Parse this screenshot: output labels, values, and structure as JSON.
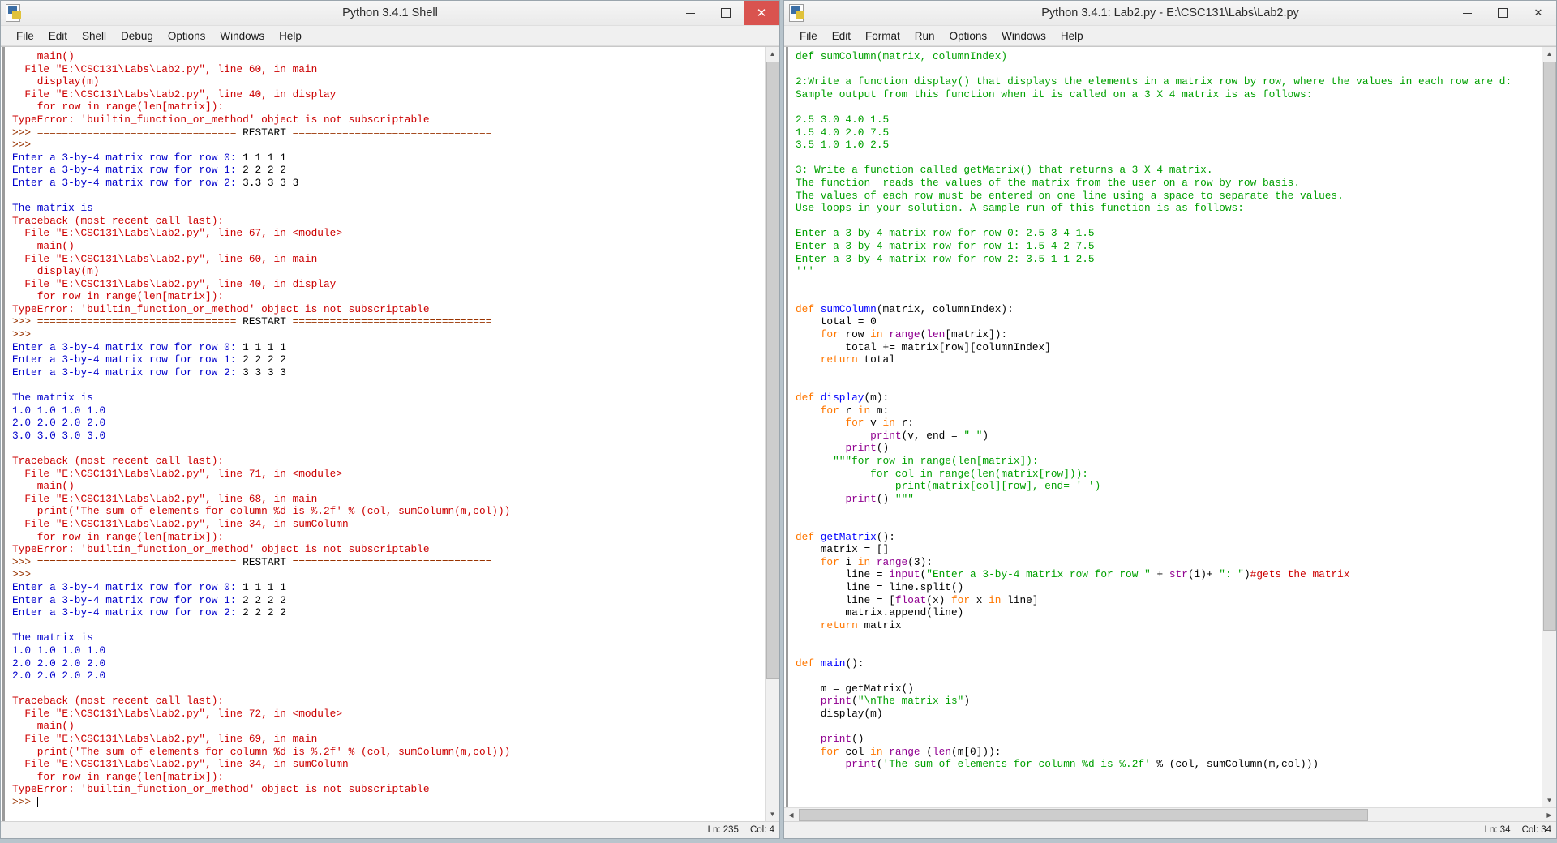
{
  "shell_window": {
    "title": "Python 3.4.1 Shell",
    "icon": "python-logo-icon",
    "menus": [
      "File",
      "Edit",
      "Shell",
      "Debug",
      "Options",
      "Windows",
      "Help"
    ],
    "window_buttons": {
      "minimize": "–",
      "maximize": "□",
      "close": "✕"
    },
    "status": {
      "line": "Ln: 235",
      "col": "Col: 4"
    },
    "output_lines": [
      {
        "t": "    main()",
        "c": "red"
      },
      {
        "t": "  File \"E:\\CSC131\\Labs\\Lab2.py\", line 60, in main",
        "c": "red"
      },
      {
        "t": "    display(m)",
        "c": "red"
      },
      {
        "t": "  File \"E:\\CSC131\\Labs\\Lab2.py\", line 40, in display",
        "c": "red"
      },
      {
        "t": "    for row in range(len[matrix]):",
        "c": "red"
      },
      {
        "t": "TypeError: 'builtin_function_or_method' object is not subscriptable",
        "c": "red"
      },
      {
        "t": ">>> ================================ RESTART ================================",
        "c": "restart"
      },
      {
        "t": ">>> ",
        "c": "brown"
      },
      {
        "t": "Enter a 3-by-4 matrix row for row 0: 1 1 1 1",
        "c": "prompt",
        "prompt": "Enter a 3-by-4 matrix row for row 0: ",
        "input": "1 1 1 1"
      },
      {
        "t": "Enter a 3-by-4 matrix row for row 1: 2 2 2 2",
        "c": "prompt",
        "prompt": "Enter a 3-by-4 matrix row for row 1: ",
        "input": "2 2 2 2"
      },
      {
        "t": "Enter a 3-by-4 matrix row for row 2: 3.3 3 3 3",
        "c": "prompt",
        "prompt": "Enter a 3-by-4 matrix row for row 2: ",
        "input": "3.3 3 3 3"
      },
      {
        "t": "",
        "c": "blank"
      },
      {
        "t": "The matrix is",
        "c": "blue"
      },
      {
        "t": "Traceback (most recent call last):",
        "c": "red"
      },
      {
        "t": "  File \"E:\\CSC131\\Labs\\Lab2.py\", line 67, in <module>",
        "c": "red"
      },
      {
        "t": "    main()",
        "c": "red"
      },
      {
        "t": "  File \"E:\\CSC131\\Labs\\Lab2.py\", line 60, in main",
        "c": "red"
      },
      {
        "t": "    display(m)",
        "c": "red"
      },
      {
        "t": "  File \"E:\\CSC131\\Labs\\Lab2.py\", line 40, in display",
        "c": "red"
      },
      {
        "t": "    for row in range(len[matrix]):",
        "c": "red"
      },
      {
        "t": "TypeError: 'builtin_function_or_method' object is not subscriptable",
        "c": "red"
      },
      {
        "t": ">>> ================================ RESTART ================================",
        "c": "restart"
      },
      {
        "t": ">>> ",
        "c": "brown"
      },
      {
        "t": "Enter a 3-by-4 matrix row for row 0: 1 1 1 1",
        "c": "prompt",
        "prompt": "Enter a 3-by-4 matrix row for row 0: ",
        "input": "1 1 1 1"
      },
      {
        "t": "Enter a 3-by-4 matrix row for row 1: 2 2 2 2",
        "c": "prompt",
        "prompt": "Enter a 3-by-4 matrix row for row 1: ",
        "input": "2 2 2 2"
      },
      {
        "t": "Enter a 3-by-4 matrix row for row 2: 3 3 3 3",
        "c": "prompt",
        "prompt": "Enter a 3-by-4 matrix row for row 2: ",
        "input": "3 3 3 3"
      },
      {
        "t": "",
        "c": "blank"
      },
      {
        "t": "The matrix is",
        "c": "blue"
      },
      {
        "t": "1.0 1.0 1.0 1.0",
        "c": "blue"
      },
      {
        "t": "2.0 2.0 2.0 2.0",
        "c": "blue"
      },
      {
        "t": "3.0 3.0 3.0 3.0",
        "c": "blue"
      },
      {
        "t": "",
        "c": "blank"
      },
      {
        "t": "Traceback (most recent call last):",
        "c": "red"
      },
      {
        "t": "  File \"E:\\CSC131\\Labs\\Lab2.py\", line 71, in <module>",
        "c": "red"
      },
      {
        "t": "    main()",
        "c": "red"
      },
      {
        "t": "  File \"E:\\CSC131\\Labs\\Lab2.py\", line 68, in main",
        "c": "red"
      },
      {
        "t": "    print('The sum of elements for column %d is %.2f' % (col, sumColumn(m,col)))",
        "c": "red"
      },
      {
        "t": "  File \"E:\\CSC131\\Labs\\Lab2.py\", line 34, in sumColumn",
        "c": "red"
      },
      {
        "t": "    for row in range(len[matrix]):",
        "c": "red"
      },
      {
        "t": "TypeError: 'builtin_function_or_method' object is not subscriptable",
        "c": "red"
      },
      {
        "t": ">>> ================================ RESTART ================================",
        "c": "restart"
      },
      {
        "t": ">>> ",
        "c": "brown"
      },
      {
        "t": "Enter a 3-by-4 matrix row for row 0: 1 1 1 1",
        "c": "prompt",
        "prompt": "Enter a 3-by-4 matrix row for row 0: ",
        "input": "1 1 1 1"
      },
      {
        "t": "Enter a 3-by-4 matrix row for row 1: 2 2 2 2",
        "c": "prompt",
        "prompt": "Enter a 3-by-4 matrix row for row 1: ",
        "input": "2 2 2 2"
      },
      {
        "t": "Enter a 3-by-4 matrix row for row 2: 2 2 2 2",
        "c": "prompt",
        "prompt": "Enter a 3-by-4 matrix row for row 2: ",
        "input": "2 2 2 2"
      },
      {
        "t": "",
        "c": "blank"
      },
      {
        "t": "The matrix is",
        "c": "blue"
      },
      {
        "t": "1.0 1.0 1.0 1.0",
        "c": "blue"
      },
      {
        "t": "2.0 2.0 2.0 2.0",
        "c": "blue"
      },
      {
        "t": "2.0 2.0 2.0 2.0",
        "c": "blue"
      },
      {
        "t": "",
        "c": "blank"
      },
      {
        "t": "Traceback (most recent call last):",
        "c": "red"
      },
      {
        "t": "  File \"E:\\CSC131\\Labs\\Lab2.py\", line 72, in <module>",
        "c": "red"
      },
      {
        "t": "    main()",
        "c": "red"
      },
      {
        "t": "  File \"E:\\CSC131\\Labs\\Lab2.py\", line 69, in main",
        "c": "red"
      },
      {
        "t": "    print('The sum of elements for column %d is %.2f' % (col, sumColumn(m,col)))",
        "c": "red"
      },
      {
        "t": "  File \"E:\\CSC131\\Labs\\Lab2.py\", line 34, in sumColumn",
        "c": "red"
      },
      {
        "t": "    for row in range(len[matrix]):",
        "c": "red"
      },
      {
        "t": "TypeError: 'builtin_function_or_method' object is not subscriptable",
        "c": "red"
      },
      {
        "t": ">>> ",
        "c": "brown-caret"
      }
    ]
  },
  "editor_window": {
    "title": "Python 3.4.1: Lab2.py - E:\\CSC131\\Labs\\Lab2.py",
    "icon": "python-logo-icon",
    "menus": [
      "File",
      "Edit",
      "Format",
      "Run",
      "Options",
      "Windows",
      "Help"
    ],
    "window_buttons": {
      "minimize": "–",
      "maximize": "□",
      "close": "✕"
    },
    "status": {
      "line": "Ln: 34",
      "col": "Col: 34"
    },
    "code_lines": [
      [
        {
          "t": "def sumColumn(matrix, columnIndex)",
          "c": "green"
        }
      ],
      [],
      [
        {
          "t": "2:Write a function display() that displays the elements in a matrix row by row, where the values in each row are d:",
          "c": "green"
        }
      ],
      [
        {
          "t": "Sample output from this function when it is called on a 3 X 4 matrix is as follows:",
          "c": "green"
        }
      ],
      [],
      [
        {
          "t": "2.5 3.0 4.0 1.5",
          "c": "green"
        }
      ],
      [
        {
          "t": "1.5 4.0 2.0 7.5",
          "c": "green"
        }
      ],
      [
        {
          "t": "3.5 1.0 1.0 2.5",
          "c": "green"
        }
      ],
      [],
      [
        {
          "t": "3: Write a function called getMatrix() that returns a 3 X 4 matrix.",
          "c": "green"
        }
      ],
      [
        {
          "t": "The function  reads the values of the matrix from the user on a row by row basis.",
          "c": "green"
        }
      ],
      [
        {
          "t": "The values of each row must be entered on one line using a space to separate the values.",
          "c": "green"
        }
      ],
      [
        {
          "t": "Use loops in your solution. A sample run of this function is as follows:",
          "c": "green"
        }
      ],
      [],
      [
        {
          "t": "Enter a 3-by-4 matrix row for row 0: 2.5 3 4 1.5",
          "c": "green"
        }
      ],
      [
        {
          "t": "Enter a 3-by-4 matrix row for row 1: 1.5 4 2 7.5",
          "c": "green"
        }
      ],
      [
        {
          "t": "Enter a 3-by-4 matrix row for row 2: 3.5 1 1 2.5",
          "c": "green"
        }
      ],
      [
        {
          "t": "'''",
          "c": "green"
        }
      ],
      [],
      [],
      [
        {
          "t": "def ",
          "c": "orange"
        },
        {
          "t": "sumColumn",
          "c": "defname"
        },
        {
          "t": "(matrix, columnIndex):",
          "c": "black"
        }
      ],
      [
        {
          "t": "    total = 0",
          "c": "black"
        }
      ],
      [
        {
          "t": "    ",
          "c": "black"
        },
        {
          "t": "for ",
          "c": "orange"
        },
        {
          "t": "row ",
          "c": "black"
        },
        {
          "t": "in ",
          "c": "orange"
        },
        {
          "t": "range",
          "c": "purple"
        },
        {
          "t": "(",
          "c": "black"
        },
        {
          "t": "len",
          "c": "purple"
        },
        {
          "t": "[matrix]):",
          "c": "black"
        }
      ],
      [
        {
          "t": "        total += matrix[row][columnIndex]",
          "c": "black"
        }
      ],
      [
        {
          "t": "    ",
          "c": "black"
        },
        {
          "t": "return ",
          "c": "orange"
        },
        {
          "t": "total",
          "c": "black"
        }
      ],
      [],
      [],
      [
        {
          "t": "def ",
          "c": "orange"
        },
        {
          "t": "display",
          "c": "defname"
        },
        {
          "t": "(m):",
          "c": "black"
        }
      ],
      [
        {
          "t": "    ",
          "c": "black"
        },
        {
          "t": "for ",
          "c": "orange"
        },
        {
          "t": "r ",
          "c": "black"
        },
        {
          "t": "in ",
          "c": "orange"
        },
        {
          "t": "m:",
          "c": "black"
        }
      ],
      [
        {
          "t": "        ",
          "c": "black"
        },
        {
          "t": "for ",
          "c": "orange"
        },
        {
          "t": "v ",
          "c": "black"
        },
        {
          "t": "in ",
          "c": "orange"
        },
        {
          "t": "r:",
          "c": "black"
        }
      ],
      [
        {
          "t": "            ",
          "c": "black"
        },
        {
          "t": "print",
          "c": "purple"
        },
        {
          "t": "(v, end = ",
          "c": "black"
        },
        {
          "t": "\" \"",
          "c": "green"
        },
        {
          "t": ")",
          "c": "black"
        }
      ],
      [
        {
          "t": "        ",
          "c": "black"
        },
        {
          "t": "print",
          "c": "purple"
        },
        {
          "t": "()",
          "c": "black"
        }
      ],
      [
        {
          "t": "      ",
          "c": "black"
        },
        {
          "t": "\"\"\"for row in range(len[matrix]):",
          "c": "green"
        }
      ],
      [
        {
          "t": "            for col in range(len(matrix[row])):",
          "c": "green"
        }
      ],
      [
        {
          "t": "                print(matrix[col][row], end= ' ')",
          "c": "green"
        }
      ],
      [
        {
          "t": "        ",
          "c": "black"
        },
        {
          "t": "print",
          "c": "purple"
        },
        {
          "t": "() ",
          "c": "black"
        },
        {
          "t": "\"\"\"",
          "c": "green"
        }
      ],
      [],
      [],
      [
        {
          "t": "def ",
          "c": "orange"
        },
        {
          "t": "getMatrix",
          "c": "defname"
        },
        {
          "t": "():",
          "c": "black"
        }
      ],
      [
        {
          "t": "    matrix = []",
          "c": "black"
        }
      ],
      [
        {
          "t": "    ",
          "c": "black"
        },
        {
          "t": "for ",
          "c": "orange"
        },
        {
          "t": "i ",
          "c": "black"
        },
        {
          "t": "in ",
          "c": "orange"
        },
        {
          "t": "range",
          "c": "purple"
        },
        {
          "t": "(3):",
          "c": "black"
        }
      ],
      [
        {
          "t": "        line = ",
          "c": "black"
        },
        {
          "t": "input",
          "c": "purple"
        },
        {
          "t": "(",
          "c": "black"
        },
        {
          "t": "\"Enter a 3-by-4 matrix row for row \"",
          "c": "green"
        },
        {
          "t": " + ",
          "c": "black"
        },
        {
          "t": "str",
          "c": "purple"
        },
        {
          "t": "(i)+ ",
          "c": "black"
        },
        {
          "t": "\": \"",
          "c": "green"
        },
        {
          "t": ")",
          "c": "black"
        },
        {
          "t": "#gets the matrix",
          "c": "red"
        }
      ],
      [
        {
          "t": "        line = line.split()",
          "c": "black"
        }
      ],
      [
        {
          "t": "        line = [",
          "c": "black"
        },
        {
          "t": "float",
          "c": "purple"
        },
        {
          "t": "(x) ",
          "c": "black"
        },
        {
          "t": "for ",
          "c": "orange"
        },
        {
          "t": "x ",
          "c": "black"
        },
        {
          "t": "in ",
          "c": "orange"
        },
        {
          "t": "line]",
          "c": "black"
        }
      ],
      [
        {
          "t": "        matrix.append(line)",
          "c": "black"
        }
      ],
      [
        {
          "t": "    ",
          "c": "black"
        },
        {
          "t": "return ",
          "c": "orange"
        },
        {
          "t": "matrix",
          "c": "black"
        }
      ],
      [],
      [],
      [
        {
          "t": "def ",
          "c": "orange"
        },
        {
          "t": "main",
          "c": "defname"
        },
        {
          "t": "():",
          "c": "black"
        }
      ],
      [],
      [
        {
          "t": "    m = getMatrix()",
          "c": "black"
        }
      ],
      [
        {
          "t": "    ",
          "c": "black"
        },
        {
          "t": "print",
          "c": "purple"
        },
        {
          "t": "(",
          "c": "black"
        },
        {
          "t": "\"\\nThe matrix is\"",
          "c": "green"
        },
        {
          "t": ")",
          "c": "black"
        }
      ],
      [
        {
          "t": "    display(m)",
          "c": "black"
        }
      ],
      [],
      [
        {
          "t": "    ",
          "c": "black"
        },
        {
          "t": "print",
          "c": "purple"
        },
        {
          "t": "()",
          "c": "black"
        }
      ],
      [
        {
          "t": "    ",
          "c": "black"
        },
        {
          "t": "for ",
          "c": "orange"
        },
        {
          "t": "col ",
          "c": "black"
        },
        {
          "t": "in ",
          "c": "orange"
        },
        {
          "t": "range ",
          "c": "purple"
        },
        {
          "t": "(",
          "c": "black"
        },
        {
          "t": "len",
          "c": "purple"
        },
        {
          "t": "(m[0])):",
          "c": "black"
        }
      ],
      [
        {
          "t": "        ",
          "c": "black"
        },
        {
          "t": "print",
          "c": "purple"
        },
        {
          "t": "(",
          "c": "black"
        },
        {
          "t": "'The sum of elements for column %d is %.2f'",
          "c": "green"
        },
        {
          "t": " % (col, sumColumn(m,col)))",
          "c": "black"
        }
      ]
    ]
  }
}
